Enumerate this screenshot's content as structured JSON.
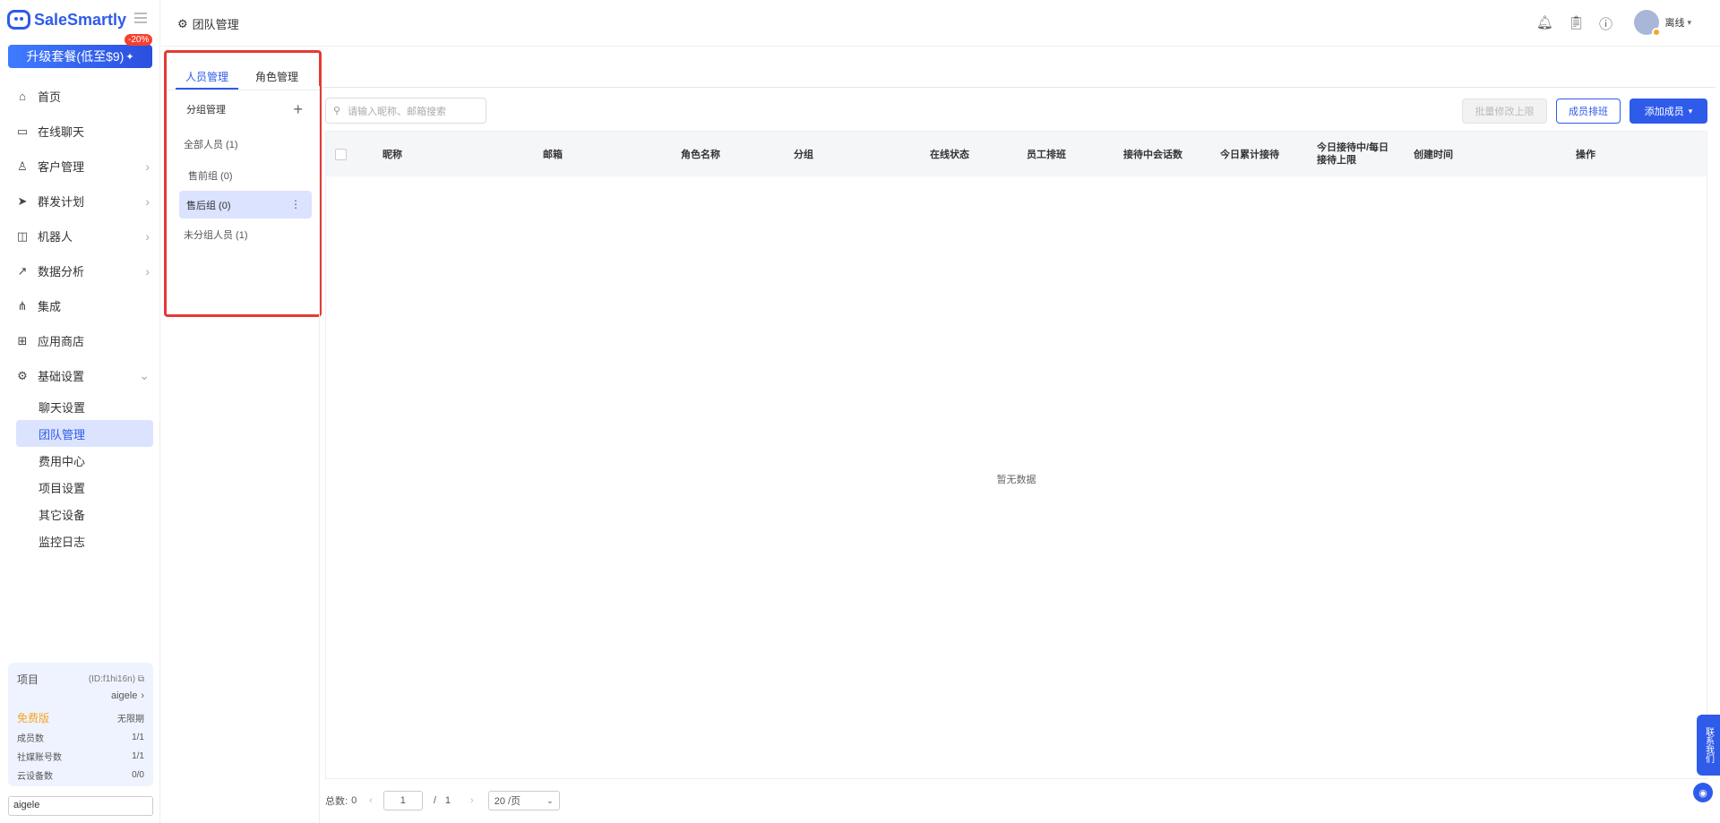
{
  "brand": {
    "name": "SaleSmartly"
  },
  "upgrade": {
    "label": "升级套餐(低至$9)",
    "badge": "-20%"
  },
  "nav": {
    "items": [
      {
        "label": "首页",
        "icon": "home-icon"
      },
      {
        "label": "在线聊天",
        "icon": "chat-icon"
      },
      {
        "label": "客户管理",
        "icon": "customers-icon"
      },
      {
        "label": "群发计划",
        "icon": "send-icon"
      },
      {
        "label": "机器人",
        "icon": "robot-icon"
      },
      {
        "label": "数据分析",
        "icon": "analytics-icon"
      },
      {
        "label": "集成",
        "icon": "integration-icon"
      },
      {
        "label": "应用商店",
        "icon": "app-store-icon"
      },
      {
        "label": "基础设置",
        "icon": "settings-icon"
      }
    ],
    "sub": [
      "聊天设置",
      "团队管理",
      "费用中心",
      "项目设置",
      "其它设备",
      "监控日志"
    ]
  },
  "project": {
    "label": "项目",
    "id": "(ID:f1hi16n)",
    "name": "aigele",
    "plan": "免费版",
    "plan_term": "无限期",
    "rows": [
      {
        "label": "成员数",
        "value": "1/1"
      },
      {
        "label": "社媒账号数",
        "value": "1/1"
      },
      {
        "label": "云设备数",
        "value": "0/0"
      }
    ]
  },
  "user_field": {
    "value": "aigele"
  },
  "header": {
    "title": "团队管理",
    "status": "离线"
  },
  "group_panel": {
    "tabs": [
      "人员管理",
      "角色管理"
    ],
    "head": "分组管理",
    "items": [
      "全部人员 (1)",
      "售前组 (0)",
      "售后组 (0)",
      "未分组人员 (1)"
    ]
  },
  "search": {
    "placeholder": "请输入昵称、邮箱搜索"
  },
  "buttons": {
    "batch": "批量修改上限",
    "schedule": "成员排班",
    "add": "添加成员"
  },
  "table": {
    "columns": [
      "昵称",
      "邮箱",
      "角色名称",
      "分组",
      "在线状态",
      "员工排班",
      "接待中会话数",
      "今日累计接待",
      "今日接待中/每日接待上限",
      "创建时间",
      "操作"
    ],
    "empty": "暂无数据"
  },
  "pagination": {
    "total_label": "总数:",
    "total": "0",
    "page": "1",
    "sep": "/",
    "pages": "1",
    "size": "20 /页"
  },
  "float": {
    "contact": "联系我们"
  },
  "colors": {
    "primary": "#2f5bea",
    "highlight": "#e53935"
  }
}
